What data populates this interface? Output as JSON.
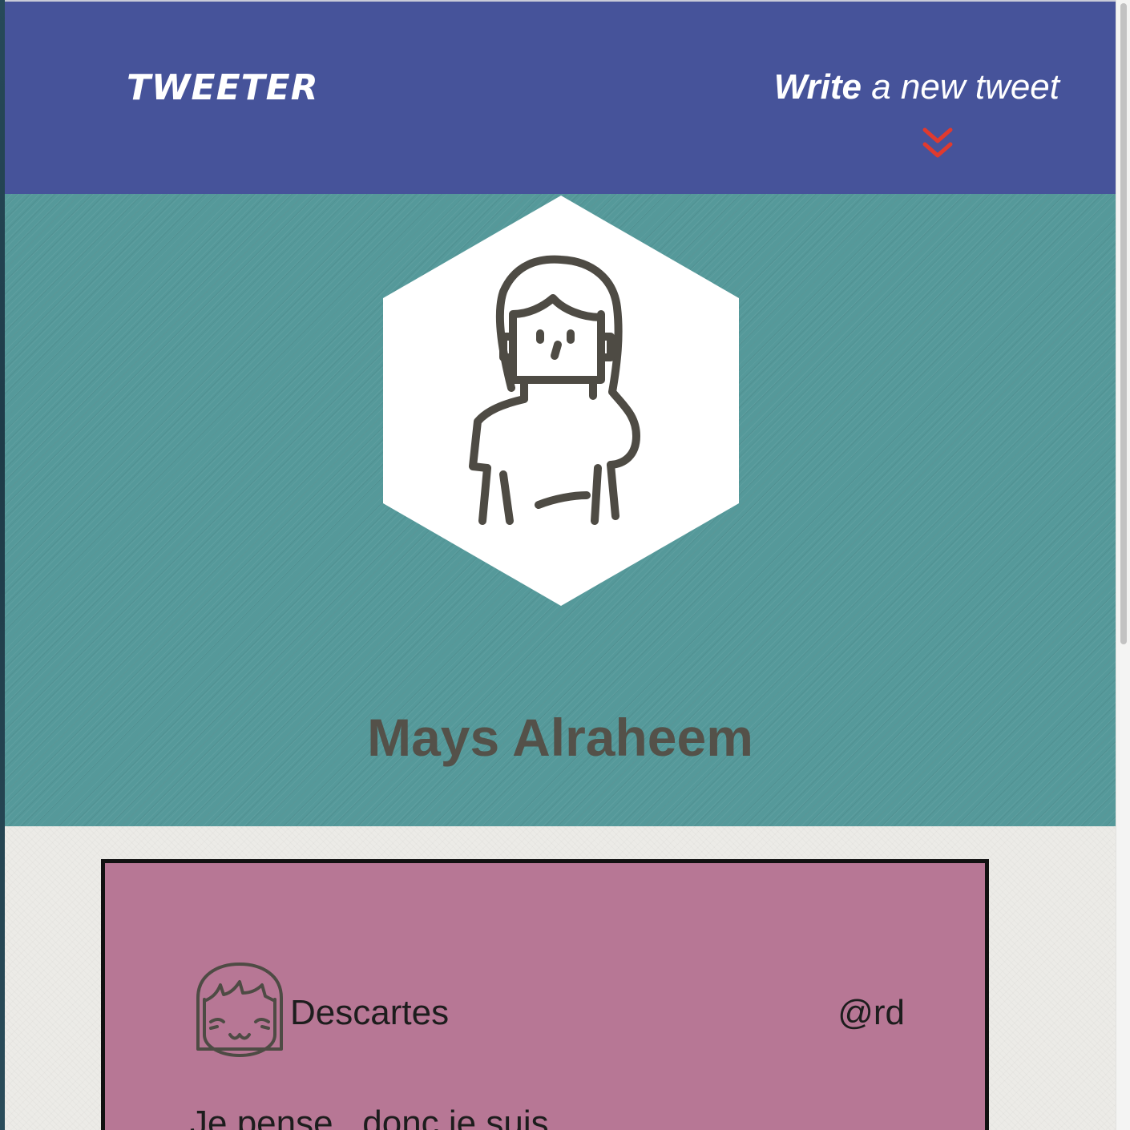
{
  "nav": {
    "brand": "TWEETER",
    "compose_bold": "Write",
    "compose_rest": " a new tweet",
    "compose_icon": "double-chevron-down-icon"
  },
  "profile": {
    "name": "Mays Alraheem",
    "avatar_icon": "woman-avatar-icon"
  },
  "tweets": [
    {
      "author": "Descartes",
      "handle": "@rd",
      "content": "Je pense , donc je suis",
      "avatar_icon": "smiling-girl-avatar-icon"
    }
  ],
  "colors": {
    "nav_bg": "#46539a",
    "profile_bg": "#55999a",
    "tweet_bg": "#b77795",
    "accent_red": "#e03a2e",
    "name_text": "#545149"
  }
}
